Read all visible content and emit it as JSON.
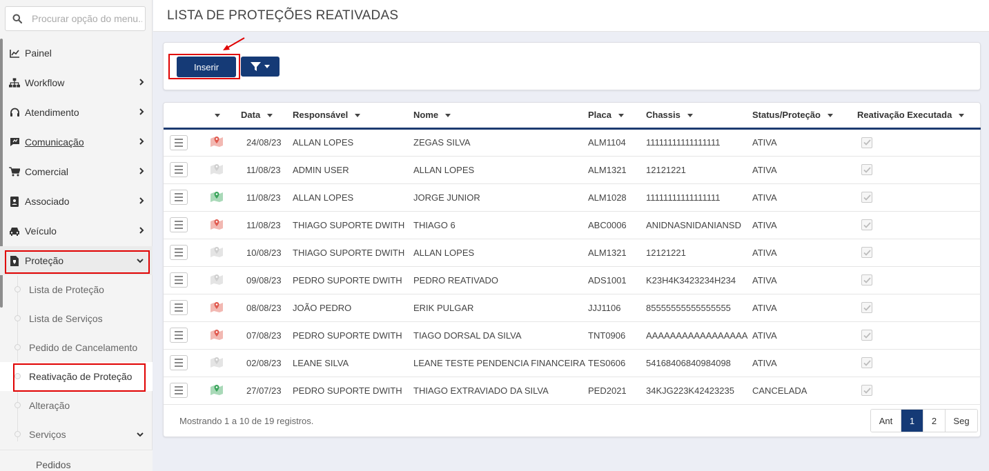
{
  "search": {
    "placeholder": "Procurar opção do menu..."
  },
  "sidebar": {
    "items": [
      {
        "label": "Painel"
      },
      {
        "label": "Workflow"
      },
      {
        "label": "Atendimento"
      },
      {
        "label": "Comunicação"
      },
      {
        "label": "Comercial"
      },
      {
        "label": "Associado"
      },
      {
        "label": "Veículo"
      },
      {
        "label": "Proteção"
      }
    ],
    "sub_items": [
      {
        "label": "Lista de Proteção"
      },
      {
        "label": "Lista de Serviços"
      },
      {
        "label": "Pedido de Cancelamento"
      },
      {
        "label": "Reativação de Proteção"
      },
      {
        "label": "Alteração"
      },
      {
        "label": "Serviços"
      }
    ],
    "sub_sub_item": {
      "label": "Pedidos"
    }
  },
  "page": {
    "title": "LISTA DE PROTEÇÕES REATIVADAS"
  },
  "toolbar": {
    "insert_label": "Inserir"
  },
  "table": {
    "headers": [
      "Data",
      "Responsável",
      "Nome",
      "Placa",
      "Chassis",
      "Status/Proteção",
      "Reativação Executada"
    ],
    "rows": [
      {
        "data": "24/08/23",
        "responsavel": "ALLAN LOPES",
        "nome": "ZEGAS SILVA",
        "placa": "ALM1104",
        "chassis": "11111111111111111",
        "status": "ATIVA",
        "map": "red"
      },
      {
        "data": "11/08/23",
        "responsavel": "ADMIN USER",
        "nome": "ALLAN LOPES",
        "placa": "ALM1321",
        "chassis": "12121221",
        "status": "ATIVA",
        "map": "gray"
      },
      {
        "data": "11/08/23",
        "responsavel": "ALLAN LOPES",
        "nome": "JORGE JUNIOR",
        "placa": "ALM1028",
        "chassis": "11111111111111111",
        "status": "ATIVA",
        "map": "green"
      },
      {
        "data": "11/08/23",
        "responsavel": "THIAGO SUPORTE DWITH",
        "nome": "THIAGO 6",
        "placa": "ABC0006",
        "chassis": "ANIDNASNIDANIANSD",
        "status": "ATIVA",
        "map": "red"
      },
      {
        "data": "10/08/23",
        "responsavel": "THIAGO SUPORTE DWITH",
        "nome": "ALLAN LOPES",
        "placa": "ALM1321",
        "chassis": "12121221",
        "status": "ATIVA",
        "map": "gray"
      },
      {
        "data": "09/08/23",
        "responsavel": "PEDRO SUPORTE DWITH",
        "nome": "PEDRO REATIVADO",
        "placa": "ADS1001",
        "chassis": "K23H4K3423234H234",
        "status": "ATIVA",
        "map": "gray"
      },
      {
        "data": "08/08/23",
        "responsavel": "JOÃO PEDRO",
        "nome": "ERIK PULGAR",
        "placa": "JJJ1106",
        "chassis": "85555555555555555",
        "status": "ATIVA",
        "map": "red"
      },
      {
        "data": "07/08/23",
        "responsavel": "PEDRO SUPORTE DWITH",
        "nome": "TIAGO DORSAL DA SILVA",
        "placa": "TNT0906",
        "chassis": "AAAAAAAAAAAAAAAAA",
        "status": "ATIVA",
        "map": "red"
      },
      {
        "data": "02/08/23",
        "responsavel": "LEANE SILVA",
        "nome": "LEANE TESTE PENDENCIA FINANCEIRA",
        "placa": "TES0606",
        "chassis": "54168406840984098",
        "status": "ATIVA",
        "map": "gray"
      },
      {
        "data": "27/07/23",
        "responsavel": "PEDRO SUPORTE DWITH",
        "nome": "THIAGO EXTRAVIADO DA SILVA",
        "placa": "PED2021",
        "chassis": "34KJG223K42423235",
        "status": "CANCELADA",
        "map": "green"
      }
    ]
  },
  "footer": {
    "showing": "Mostrando 1 a 10 de 19 registros."
  },
  "pagination": {
    "prev": "Ant",
    "pages": [
      "1",
      "2"
    ],
    "next": "Seg"
  },
  "colors": {
    "primary": "#153a76",
    "highlight": "#e00000",
    "map_red": "#e05a4f",
    "map_green": "#3ba55c",
    "map_gray": "#cfcfcf"
  }
}
